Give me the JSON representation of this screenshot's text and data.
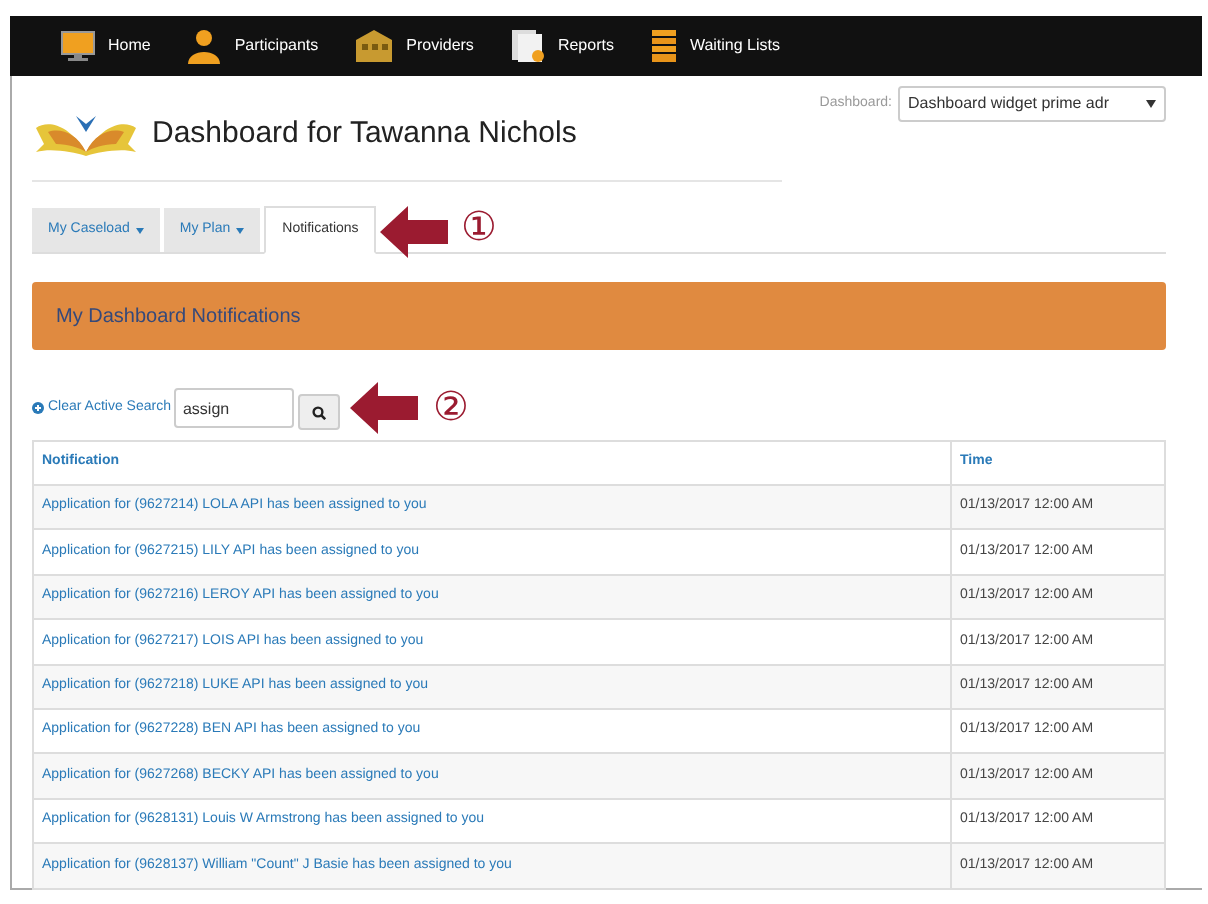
{
  "nav": [
    {
      "label": "Home"
    },
    {
      "label": "Participants"
    },
    {
      "label": "Providers"
    },
    {
      "label": "Reports"
    },
    {
      "label": "Waiting Lists"
    }
  ],
  "header": {
    "title": "Dashboard for Tawanna Nichols",
    "dashboard_label": "Dashboard:",
    "dashboard_value": "Dashboard widget prime adr"
  },
  "tabs": [
    {
      "label": "My Caseload",
      "dropdown": true,
      "selected": false
    },
    {
      "label": "My Plan",
      "dropdown": true,
      "selected": false
    },
    {
      "label": "Notifications",
      "dropdown": false,
      "selected": true
    }
  ],
  "callouts": [
    "①",
    "②"
  ],
  "banner": "My Dashboard Notifications",
  "search": {
    "clear_link": "Clear Active Search",
    "value": "assign"
  },
  "table": {
    "columns": [
      "Notification",
      "Time"
    ],
    "rows": [
      [
        "Application for (9627214) LOLA API has been assigned to you",
        "01/13/2017 12:00 AM"
      ],
      [
        "Application for (9627215) LILY API has been assigned to you",
        "01/13/2017 12:00 AM"
      ],
      [
        "Application for (9627216) LEROY API has been assigned to you",
        "01/13/2017 12:00 AM"
      ],
      [
        "Application for (9627217) LOIS API has been assigned to you",
        "01/13/2017 12:00 AM"
      ],
      [
        "Application for (9627218) LUKE API has been assigned to you",
        "01/13/2017 12:00 AM"
      ],
      [
        "Application for (9627228) BEN API has been assigned to you",
        "01/13/2017 12:00 AM"
      ],
      [
        "Application for (9627268) BECKY API has been assigned to you",
        "01/13/2017 12:00 AM"
      ],
      [
        "Application for (9628131) Louis W Armstrong has been assigned to you",
        "01/13/2017 12:00 AM"
      ],
      [
        "Application for (9628137) William \"Count\" J Basie has been assigned to you",
        "01/13/2017 12:00 AM"
      ]
    ]
  }
}
